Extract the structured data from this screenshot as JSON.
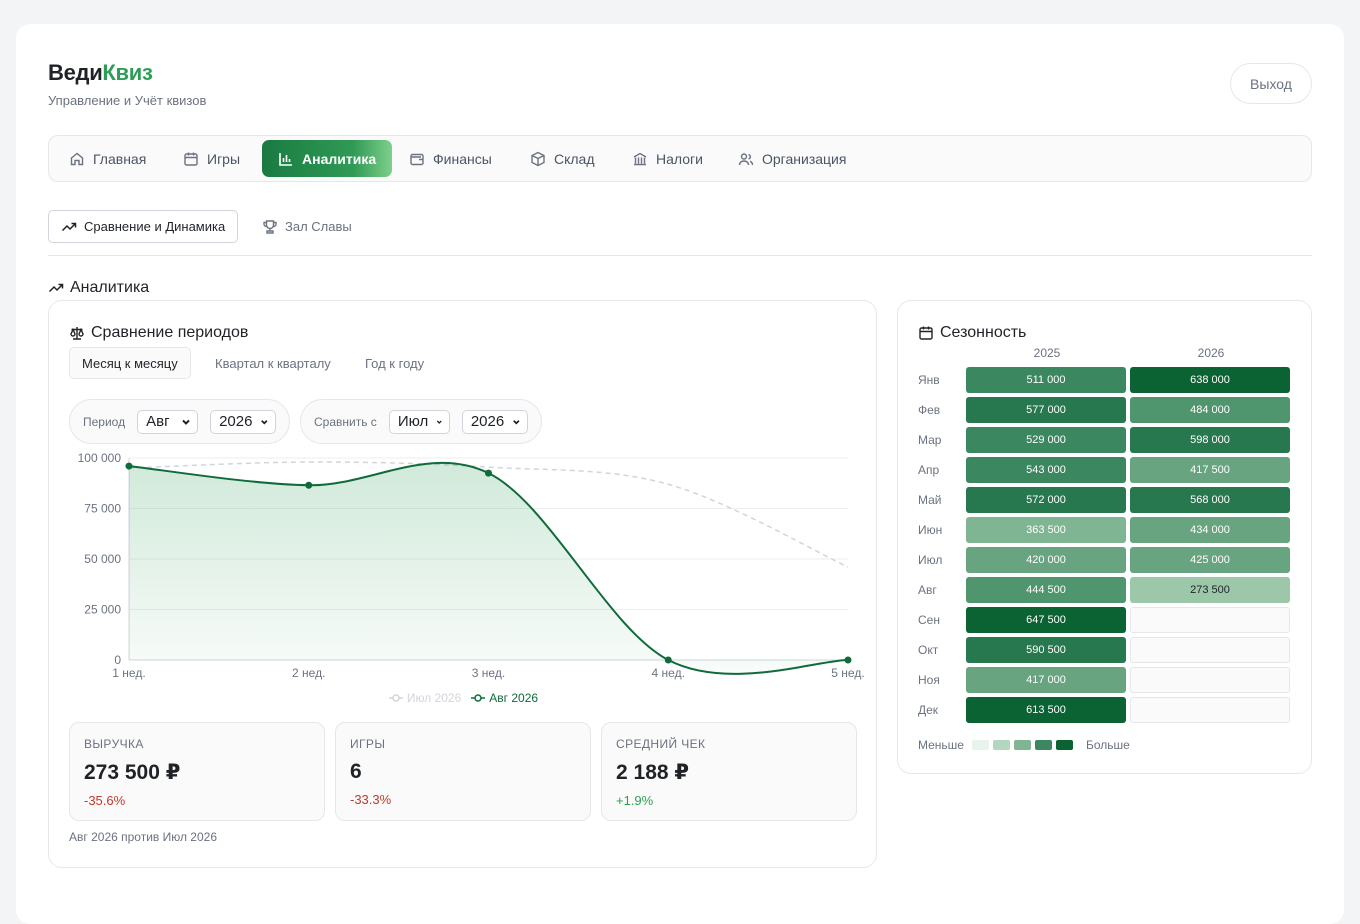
{
  "app": {
    "brand_part1": "Веди",
    "brand_part2": "Квиз",
    "subtitle": "Управление и Учёт квизов",
    "logout_label": "Выход"
  },
  "nav": {
    "items": [
      {
        "label": "Главная",
        "icon": "home-icon"
      },
      {
        "label": "Игры",
        "icon": "calendar-icon"
      },
      {
        "label": "Аналитика",
        "icon": "bar-chart-icon",
        "active": true
      },
      {
        "label": "Финансы",
        "icon": "wallet-icon"
      },
      {
        "label": "Склад",
        "icon": "box-icon"
      },
      {
        "label": "Налоги",
        "icon": "bank-icon"
      },
      {
        "label": "Организация",
        "icon": "users-icon"
      }
    ]
  },
  "subtabs": {
    "compare": "Сравнение и Динамика",
    "fame": "Зал Славы"
  },
  "section": {
    "title": "Аналитика"
  },
  "comparison": {
    "title": "Сравнение периодов",
    "tabs": [
      "Месяц к месяцу",
      "Квартал к кварталу",
      "Год к году"
    ],
    "period_label": "Период",
    "period_month": "Авг",
    "period_year": "2026",
    "compare_label": "Сравнить с",
    "compare_month": "Июл",
    "compare_year": "2026",
    "footnote": "Авг 2026 против Июл 2026"
  },
  "chart_data": {
    "type": "line",
    "x": [
      "1 нед.",
      "2 нед.",
      "3 нед.",
      "4 нед.",
      "5 нед."
    ],
    "yticks": [
      "0",
      "25 000",
      "50 000",
      "75 000",
      "100 000"
    ],
    "ylim": [
      0,
      100000
    ],
    "series": [
      {
        "name": "Июл 2026",
        "values": [
          95000,
          98000,
          95500,
          87000,
          46000
        ],
        "color": "#d1d5db",
        "style": "dashed"
      },
      {
        "name": "Авг 2026",
        "values": [
          96000,
          86500,
          92500,
          0,
          0
        ],
        "color": "#0f6b3a",
        "style": "solid"
      }
    ],
    "legend_position": "bottom-center",
    "grid": true
  },
  "kpis": [
    {
      "label": "ВЫРУЧКА",
      "value": "273 500 ₽",
      "change": "-35.6%",
      "trend": "negative"
    },
    {
      "label": "ИГРЫ",
      "value": "6",
      "change": "-33.3%",
      "trend": "negative"
    },
    {
      "label": "СРЕДНИЙ ЧЕК",
      "value": "2 188 ₽",
      "change": "+1.9%",
      "trend": "positive"
    }
  ],
  "seasonality": {
    "title": "Сезонность",
    "years": [
      "2025",
      "2026"
    ],
    "rows": [
      {
        "month": "Янв",
        "v2025": "511 000",
        "v2026": "638 000",
        "l2025": 4,
        "l2026": 6
      },
      {
        "month": "Фев",
        "v2025": "577 000",
        "v2026": "484 000",
        "l2025": 5,
        "l2026": 3
      },
      {
        "month": "Мар",
        "v2025": "529 000",
        "v2026": "598 000",
        "l2025": 4,
        "l2026": 5
      },
      {
        "month": "Апр",
        "v2025": "543 000",
        "v2026": "417 500",
        "l2025": 4,
        "l2026": 2
      },
      {
        "month": "Май",
        "v2025": "572 000",
        "v2026": "568 000",
        "l2025": 5,
        "l2026": 5
      },
      {
        "month": "Июн",
        "v2025": "363 500",
        "v2026": "434 000",
        "l2025": 1,
        "l2026": 2
      },
      {
        "month": "Июл",
        "v2025": "420 000",
        "v2026": "425 000",
        "l2025": 2,
        "l2026": 2
      },
      {
        "month": "Авг",
        "v2025": "444 500",
        "v2026": "273 500",
        "l2025": 3,
        "l2026": 0
      },
      {
        "month": "Сен",
        "v2025": "647 500",
        "v2026": "",
        "l2025": 6,
        "l2026": -1
      },
      {
        "month": "Окт",
        "v2025": "590 500",
        "v2026": "",
        "l2025": 5,
        "l2026": -1
      },
      {
        "month": "Ноя",
        "v2025": "417 000",
        "v2026": "",
        "l2025": 2,
        "l2026": -1
      },
      {
        "month": "Дек",
        "v2025": "613 500",
        "v2026": "",
        "l2025": 6,
        "l2026": -1
      }
    ],
    "scale_less": "Меньше",
    "scale_more": "Больше",
    "colors": [
      "#9cc7a9",
      "#7fb592",
      "#67a47f",
      "#4f956d",
      "#3b8760",
      "#27784f",
      "#0b6232"
    ],
    "scale_swatches": [
      "#e8f3ec",
      "#b3d6bf",
      "#7fb592",
      "#3b8760",
      "#0b6232"
    ]
  }
}
